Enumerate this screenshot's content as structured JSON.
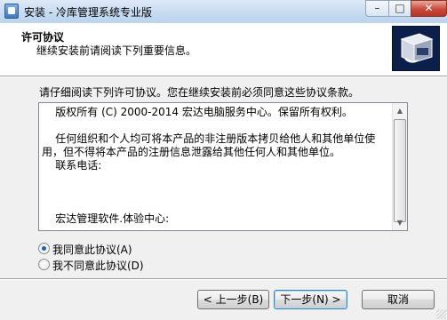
{
  "window": {
    "title": "安装 - 冷库管理系统专业版",
    "minimize": "–",
    "maximize": "□",
    "close": "✕"
  },
  "header": {
    "title": "许可协议",
    "subtitle": "继续安装前请阅读下列重要信息。",
    "graphic_icon": "installer-box-icon"
  },
  "intro": "请仔细阅读下列许可协议。您在继续安装前必须同意这些协议条款。",
  "license": {
    "text": "    版权所有 (C) 2000-2014 宏达电脑服务中心。保留所有权利。\n\n    任何组织和个人均可将本产品的非注册版本拷贝给他人和其他单位使用，但不得将本产品的注册信息泄露给其他任何人和其他单位。\n    联系电话:\n\n\n\n    宏达管理软件.体验中心:"
  },
  "scrollbar": {
    "up": "▲",
    "down": "▼"
  },
  "options": {
    "accept": "我同意此协议(A)",
    "decline": "我不同意此协议(D)",
    "selected": "accept"
  },
  "buttons": {
    "back": "< 上一步(B)",
    "next": "下一步(N) >",
    "cancel": "取消"
  }
}
